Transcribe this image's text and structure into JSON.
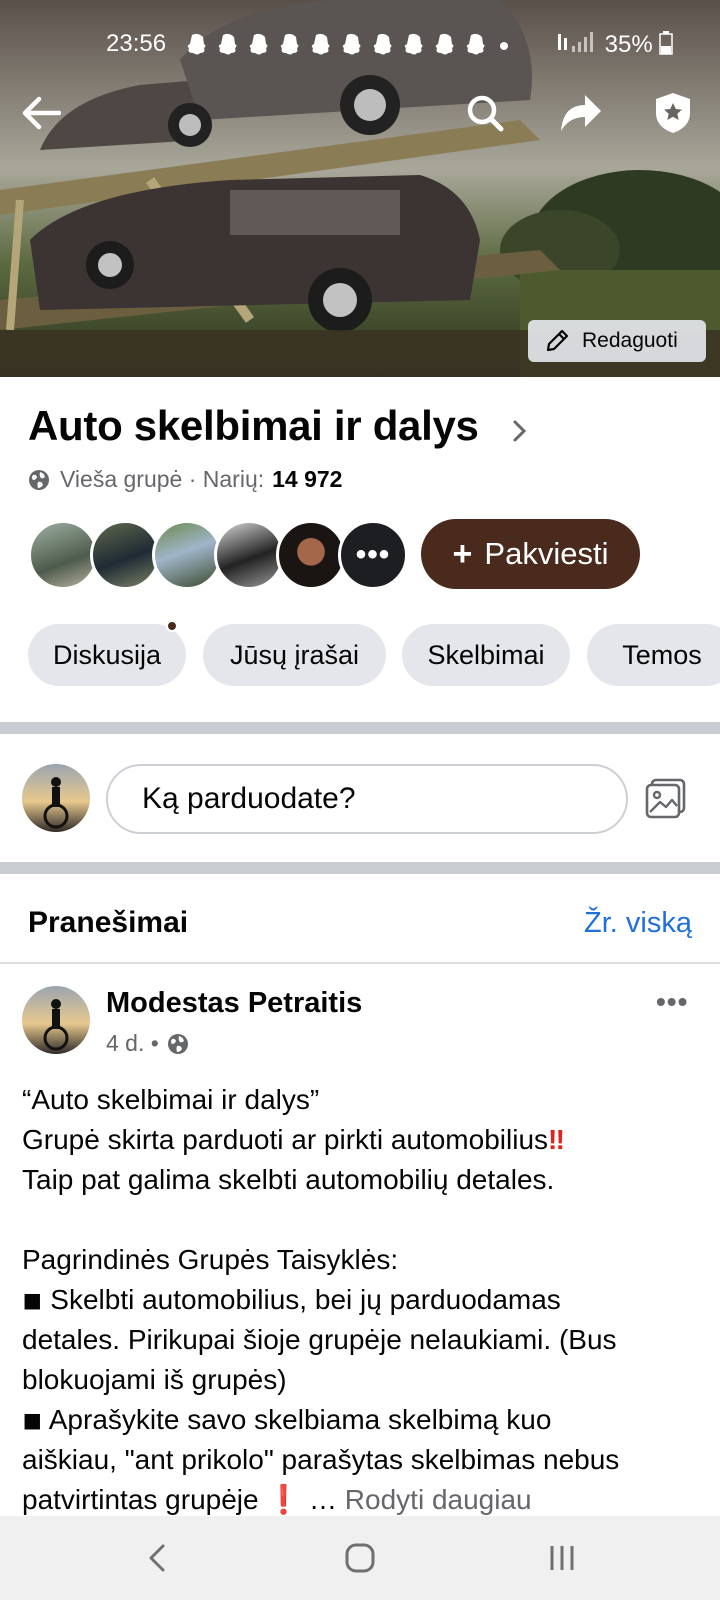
{
  "status_bar": {
    "time": "23:56",
    "notifications": "👻👻👻👻👻👻👻👻👻👻 •",
    "battery": "35%"
  },
  "cover": {
    "edit_label": "Redaguoti"
  },
  "group": {
    "name": "Auto skelbimai ir dalys",
    "privacy": "Vieša grupė · Narių:",
    "member_count": "14 972",
    "invite_label": "Pakviesti",
    "avatar_more": "•••"
  },
  "tabs": [
    {
      "label": "Diskusija",
      "has_dot": true
    },
    {
      "label": "Jūsų įrašai"
    },
    {
      "label": "Skelbimai"
    },
    {
      "label": "Temos"
    }
  ],
  "composer": {
    "placeholder": "Ką parduodate?"
  },
  "announcements": {
    "heading": "Pranešimai",
    "see_all": "Žr. viską",
    "post": {
      "author": "Modestas Petraitis",
      "time": "4 d. •",
      "lines": [
        "“Auto skelbimai ir dalys”",
        "Grupė skirta parduoti ar pirkti automobilius",
        "Taip pat galima skelbti automobilių detales.",
        "",
        "Pagrindinės Grupės Taisyklės:",
        " ◾ Skelbti automobilius, bei jų parduodamas",
        "detales. Pirikupai šioje grupėje nelaukiami. (Bus",
        "blokuojami iš grupės)",
        " ◾ Aprašykite savo skelbiama skelbimą kuo",
        "aiškiau, \"ant prikolo\" parašytas skelbimas nebus",
        "patvirtintas grupėje "
      ],
      "emphasis_mark": "‼",
      "exclaim_mark": "❗",
      "ellipsis": "…",
      "show_more": "Rodyti daugiau"
    }
  },
  "colors": {
    "brand_brown": "#4a2a1d",
    "link_blue": "#216fdb",
    "chip_bg": "#e4e6eb"
  }
}
